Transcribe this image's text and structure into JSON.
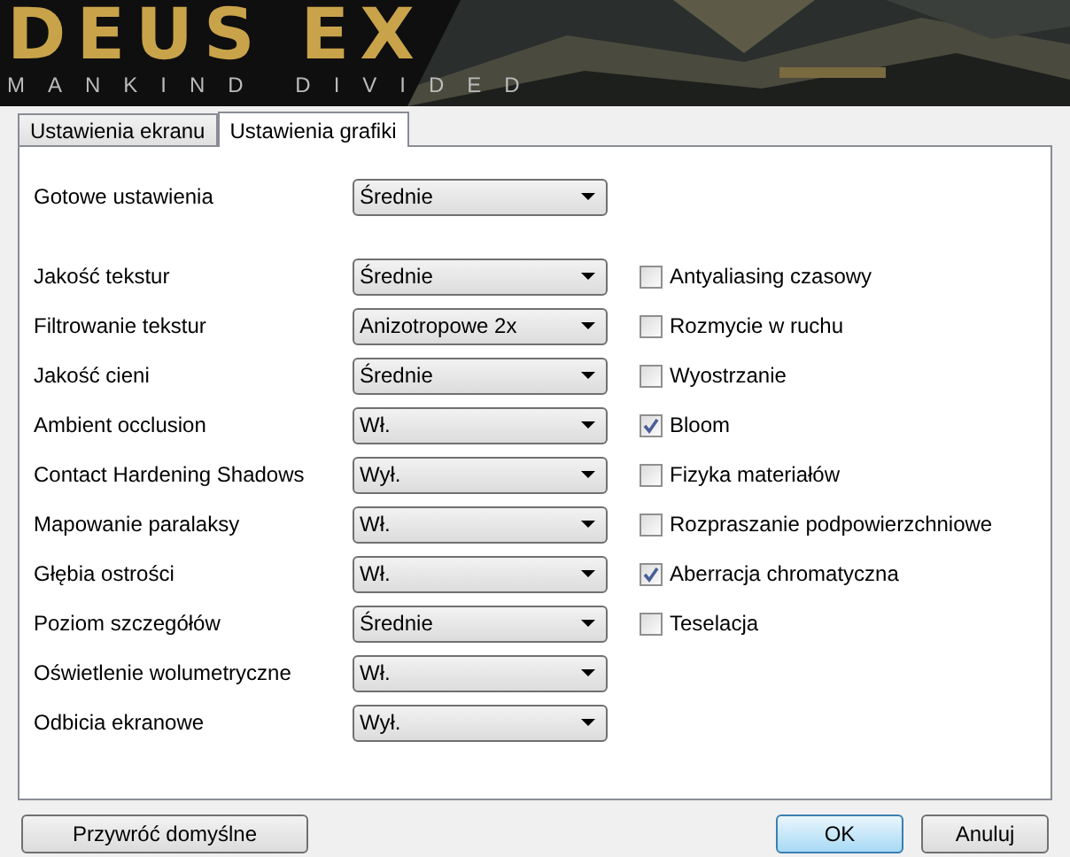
{
  "banner": {
    "title": "DEUS EX",
    "subtitle": "MANKIND DIVIDED",
    "kind": "picture"
  },
  "tabs": [
    {
      "label": "Ustawienia ekranu",
      "selected": false
    },
    {
      "label": "Ustawienia grafiki",
      "selected": true
    }
  ],
  "preset": {
    "label": "Gotowe ustawienia",
    "value": "Średnie"
  },
  "settings": [
    {
      "label": "Jakość tekstur",
      "value": "Średnie"
    },
    {
      "label": "Filtrowanie tekstur",
      "value": "Anizotropowe 2x"
    },
    {
      "label": "Jakość cieni",
      "value": "Średnie"
    },
    {
      "label": "Ambient occlusion",
      "value": "Wł."
    },
    {
      "label": "Contact Hardening Shadows",
      "value": "Wył."
    },
    {
      "label": "Mapowanie paralaksy",
      "value": "Wł."
    },
    {
      "label": "Głębia ostrości",
      "value": "Wł."
    },
    {
      "label": "Poziom szczegółów",
      "value": "Średnie"
    },
    {
      "label": "Oświetlenie wolumetryczne",
      "value": "Wł."
    },
    {
      "label": "Odbicia ekranowe",
      "value": "Wył."
    }
  ],
  "effects": [
    {
      "label": "Antyaliasing czasowy",
      "checked": false
    },
    {
      "label": "Rozmycie w ruchu",
      "checked": false
    },
    {
      "label": "Wyostrzanie",
      "checked": false
    },
    {
      "label": "Bloom",
      "checked": true
    },
    {
      "label": "Fizyka materiałów",
      "checked": false
    },
    {
      "label": "Rozpraszanie podpowierzchniowe",
      "checked": false
    },
    {
      "label": "Aberracja chromatyczna",
      "checked": true
    },
    {
      "label": "Teselacja",
      "checked": false
    }
  ],
  "buttons": {
    "reset": "Przywróć domyślne",
    "ok": "OK",
    "cancel": "Anuluj"
  }
}
